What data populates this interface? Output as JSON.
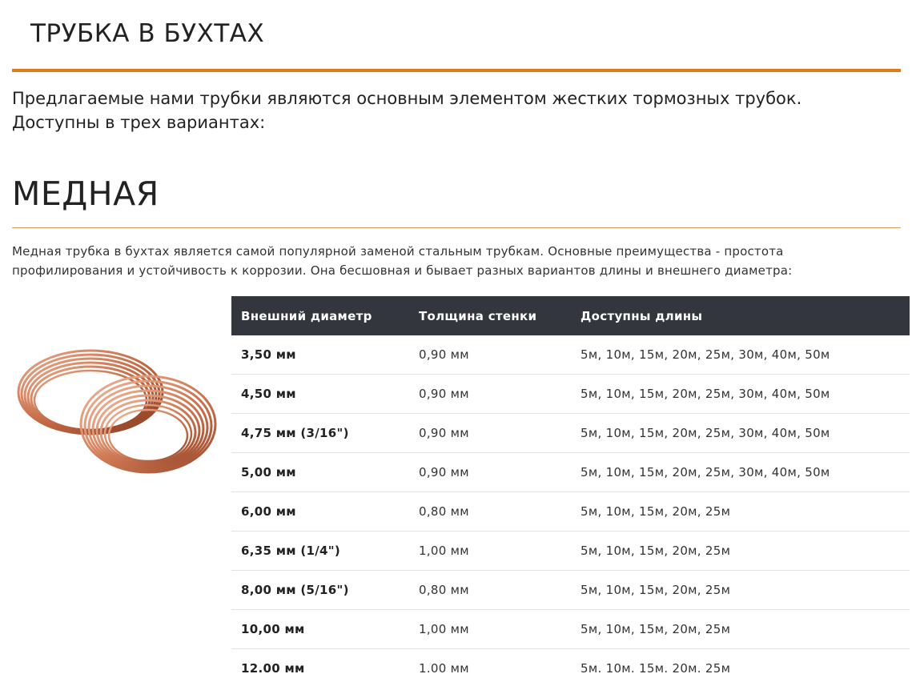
{
  "page": {
    "title": "ТРУБКА В БУХТАХ",
    "intro_line1": "Предлагаемые нами трубки являются основным элементом жестких тормозных трубок.",
    "intro_line2": "Доступны в трех вариантах:"
  },
  "section": {
    "title": "МЕДНАЯ",
    "description_line1": "Медная трубка в бухтах является самой популярной заменой стальным трубкам. Основные преимущества - простота",
    "description_line2": "профилирования и устойчивость к коррозии. Она бесшовная и бывает разных вариантов длины и внешнего диаметра:",
    "image_icon": "copper-coil-image"
  },
  "table": {
    "headers": [
      "Внешний диаметр",
      "Толщина стенки",
      "Доступны длины"
    ],
    "rows": [
      [
        "3,50 мм",
        "0,90 мм",
        "5м, 10м, 15м, 20м, 25м, 30м, 40м, 50м"
      ],
      [
        "4,50 мм",
        "0,90 мм",
        "5м, 10м, 15м, 20м, 25м, 30м, 40м, 50м"
      ],
      [
        "4,75 мм (3/16\")",
        "0,90 мм",
        "5м, 10м, 15м, 20м, 25м, 30м, 40м, 50м"
      ],
      [
        "5,00 мм",
        "0,90 мм",
        "5м, 10м, 15м, 20м, 25м, 30м, 40м, 50м"
      ],
      [
        "6,00 мм",
        "0,80 мм",
        "5м, 10м, 15м, 20м, 25м"
      ],
      [
        "6,35 мм (1/4\")",
        "1,00 мм",
        "5м, 10м, 15м, 20м, 25м"
      ],
      [
        "8,00 мм (5/16\")",
        "0,80 мм",
        "5м, 10м, 15м, 20м, 25м"
      ],
      [
        "10,00 мм",
        "1,00 мм",
        "5м, 10м, 15м, 20м, 25м"
      ],
      [
        "12.00 мм",
        "1.00 мм",
        "5м. 10м. 15м. 20м. 25м"
      ]
    ]
  },
  "colors": {
    "accent": "#e07b1a",
    "table_header_bg": "#33373d",
    "copper": "#c8754f"
  }
}
